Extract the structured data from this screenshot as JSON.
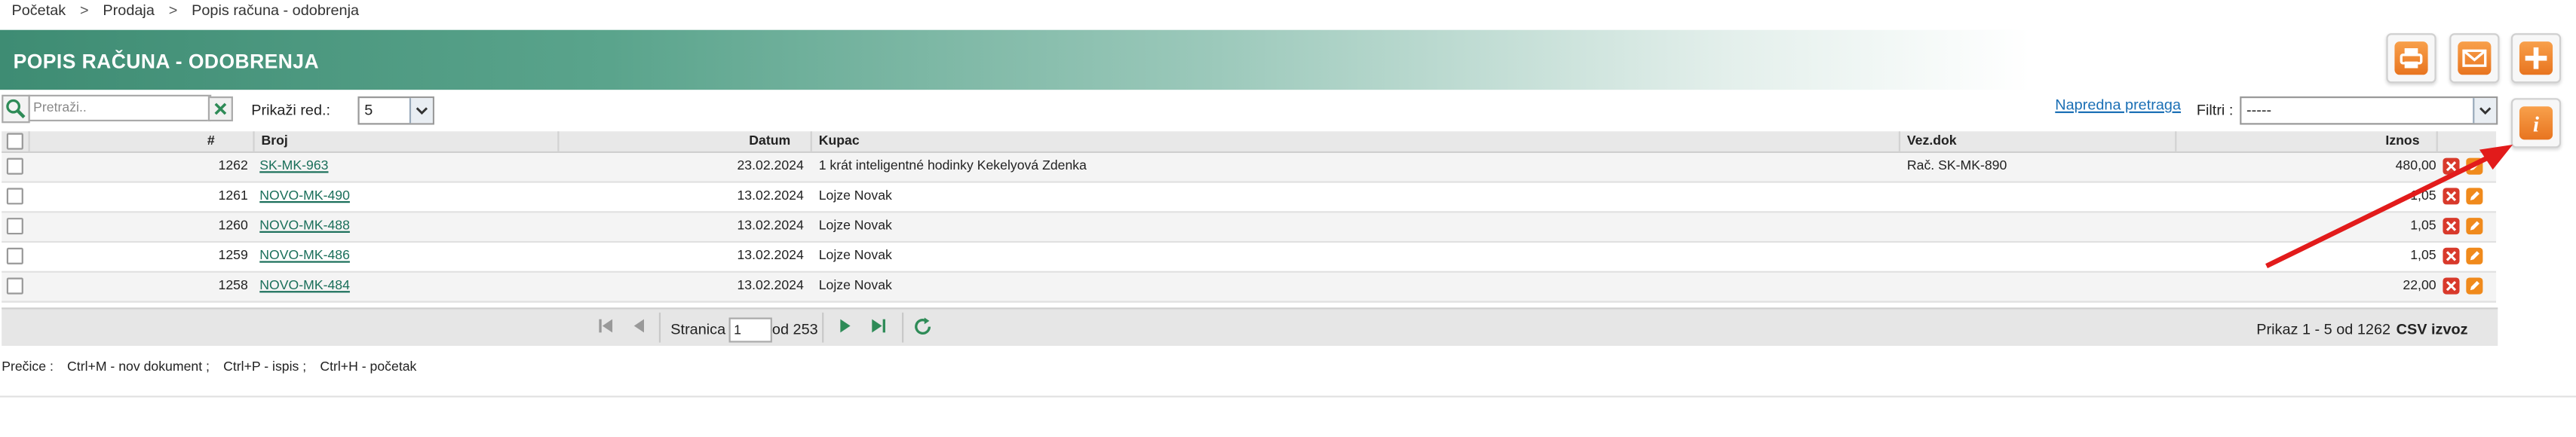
{
  "breadcrumb": {
    "items": [
      "Početak",
      "Prodaja",
      "Popis računa - odobrenja"
    ],
    "separator": ">"
  },
  "page": {
    "title": "POPIS RAČUNA - ODOBRENJA"
  },
  "actions": {
    "print_icon": "printer-icon",
    "email_icon": "envelope-icon",
    "add_icon": "plus-icon",
    "info_icon": "info-icon",
    "accent_color": "#f08a1c"
  },
  "toolbar": {
    "search_placeholder": "Pretraži..",
    "rows_label": "Prikaži red.:",
    "rows_value": "5",
    "advanced_search": "Napredna pretraga",
    "filter_label": "Filtri :",
    "filter_value": "-----"
  },
  "table": {
    "columns": {
      "num": "#",
      "broj": "Broj",
      "datum": "Datum",
      "kupac": "Kupac",
      "vezdok": "Vez.dok",
      "iznos": "Iznos"
    },
    "rows": [
      {
        "num": "1262",
        "broj": "SK-MK-963",
        "datum": "23.02.2024",
        "kupac": "1 krát inteligentné hodinky Kekelyová Zdenka",
        "vezdok": "Rač. SK-MK-890",
        "iznos": "480,00"
      },
      {
        "num": "1261",
        "broj": "NOVO-MK-490",
        "datum": "13.02.2024",
        "kupac": "Lojze Novak",
        "vezdok": "",
        "iznos": "1,05"
      },
      {
        "num": "1260",
        "broj": "NOVO-MK-488",
        "datum": "13.02.2024",
        "kupac": "Lojze Novak",
        "vezdok": "",
        "iznos": "1,05"
      },
      {
        "num": "1259",
        "broj": "NOVO-MK-486",
        "datum": "13.02.2024",
        "kupac": "Lojze Novak",
        "vezdok": "",
        "iznos": "1,05"
      },
      {
        "num": "1258",
        "broj": "NOVO-MK-484",
        "datum": "13.02.2024",
        "kupac": "Lojze Novak",
        "vezdok": "",
        "iznos": "22,00"
      }
    ]
  },
  "pager": {
    "page_label": "Stranica",
    "page_value": "1",
    "of_label": "od 253",
    "summary": "Prikaz 1 - 5 od 1262",
    "csv": "CSV izvoz"
  },
  "shortcuts": {
    "label": "Prečice :",
    "items": [
      "Ctrl+M - nov dokument ;",
      "Ctrl+P - ispis ;",
      "Ctrl+H - početak"
    ]
  }
}
